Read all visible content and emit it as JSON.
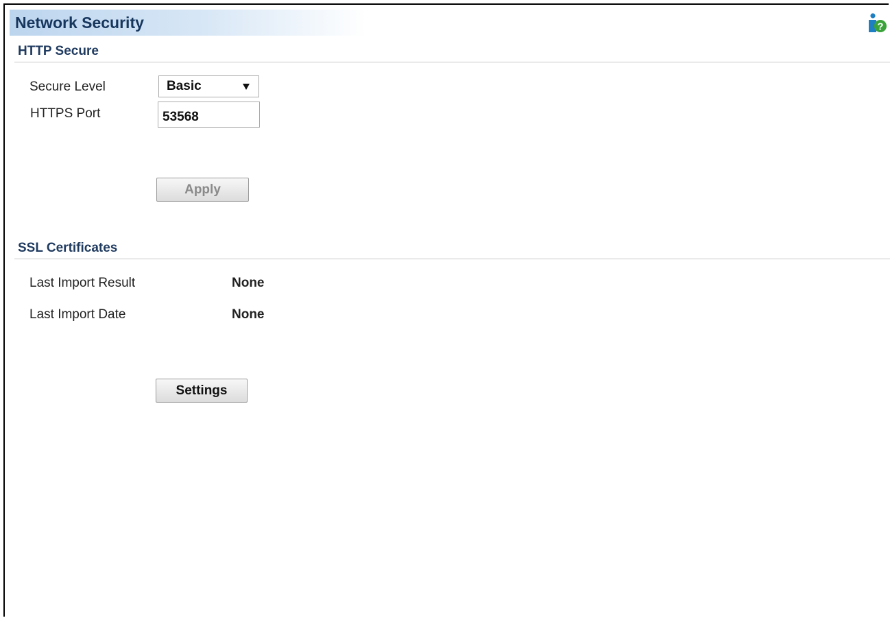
{
  "header": {
    "title": "Network Security",
    "help_icon": "help-icon"
  },
  "http_secure": {
    "section_title": "HTTP Secure",
    "secure_level_label": "Secure Level",
    "secure_level_value": "Basic",
    "https_port_label": "HTTPS Port",
    "https_port_value": "53568",
    "apply_label": "Apply",
    "apply_disabled": true
  },
  "ssl_certificates": {
    "section_title": "SSL Certificates",
    "rows": [
      {
        "label": "Last Import Result",
        "value": "None"
      },
      {
        "label": "Last Import Date",
        "value": "None"
      }
    ],
    "settings_label": "Settings"
  },
  "colors": {
    "title_text": "#17365d",
    "title_gradient_start": "#bcd5ee",
    "help_icon_blue": "#1e7fc2",
    "help_icon_green": "#3aa43a"
  }
}
